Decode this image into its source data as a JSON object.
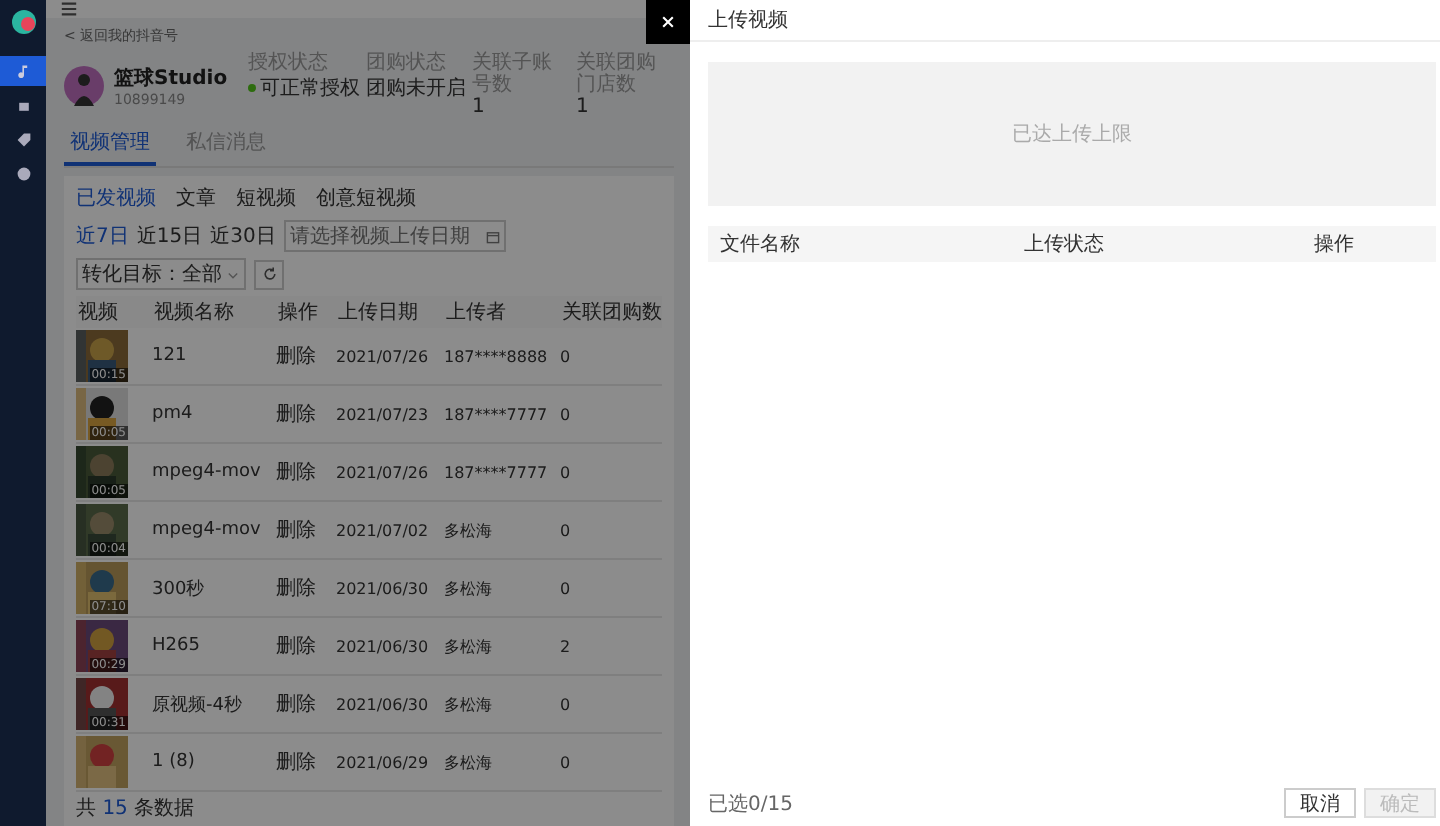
{
  "sidebar": {
    "items": [
      {
        "kind": "video",
        "selected": true
      },
      {
        "kind": "shop",
        "selected": false
      },
      {
        "kind": "ticket",
        "selected": false
      },
      {
        "kind": "info",
        "selected": false
      }
    ]
  },
  "back_link": "< 返回我的抖音号",
  "account": {
    "name": "篮球Studio",
    "id": "10899149",
    "fields": [
      {
        "label": "授权状态",
        "value": "可正常授权",
        "color": "#2d6c0e"
      },
      {
        "label": "团购状态",
        "value": "团购未开启"
      },
      {
        "label": "关联子账号数",
        "value": "1"
      },
      {
        "label": "关联团购门店数",
        "value": "1"
      }
    ]
  },
  "tabs": [
    {
      "label": "视频管理",
      "selected": true
    },
    {
      "label": "私信消息",
      "selected": false
    }
  ],
  "sub_tabs": [
    {
      "label": "已发视频",
      "selected": true
    },
    {
      "label": "文章",
      "selected": false
    },
    {
      "label": "短视频",
      "selected": false
    },
    {
      "label": "创意短视频",
      "selected": false
    }
  ],
  "date_ranges": [
    {
      "label": "近7日",
      "selected": true
    },
    {
      "label": "近15日",
      "selected": false
    },
    {
      "label": "近30日",
      "selected": false
    }
  ],
  "date_field": {
    "placeholder": "请选择视频上传日期"
  },
  "target_select": {
    "value": "转化目标：全部"
  },
  "table": {
    "columns": [
      "视频",
      "视频名称",
      "操作",
      "上传日期",
      "上传者",
      "关联团购数"
    ],
    "rows": [
      {
        "duration": "00:15",
        "name": "121",
        "action": "删除",
        "date": "2021/07/26",
        "uploader": "187****8888",
        "count": "0"
      },
      {
        "duration": "00:05",
        "name": "pm4",
        "action": "删除",
        "date": "2021/07/23",
        "uploader": "187****7777",
        "count": "0"
      },
      {
        "duration": "00:05",
        "name": "mpeg4-mov",
        "action": "删除",
        "date": "2021/07/26",
        "uploader": "187****7777",
        "count": "0"
      },
      {
        "duration": "00:04",
        "name": "mpeg4-mov",
        "action": "删除",
        "date": "2021/07/02",
        "uploader": "多松海",
        "count": "0"
      },
      {
        "duration": "07:10",
        "name": "300秒",
        "action": "删除",
        "date": "2021/06/30",
        "uploader": "多松海",
        "count": "0"
      },
      {
        "duration": "00:29",
        "name": "H265",
        "action": "删除",
        "date": "2021/06/30",
        "uploader": "多松海",
        "count": "2"
      },
      {
        "duration": "00:31",
        "name": "原视频-4秒",
        "action": "删除",
        "date": "2021/06/30",
        "uploader": "多松海",
        "count": "0"
      },
      {
        "name": "1 (8)",
        "action": "删除",
        "date": "2021/06/29",
        "uploader": "多松海",
        "count": "0"
      }
    ]
  },
  "pagination": {
    "prefix": "共",
    "total": "15",
    "suffix": "条数据"
  },
  "drawer": {
    "title": "上传视频",
    "upload_area": "已达上传上限",
    "columns": [
      "文件名称",
      "上传状态",
      "操作"
    ],
    "selected_count": "已选0/15",
    "buttons": [
      {
        "label": "取消",
        "disabled": false
      },
      {
        "label": "确定",
        "disabled": true
      }
    ]
  }
}
